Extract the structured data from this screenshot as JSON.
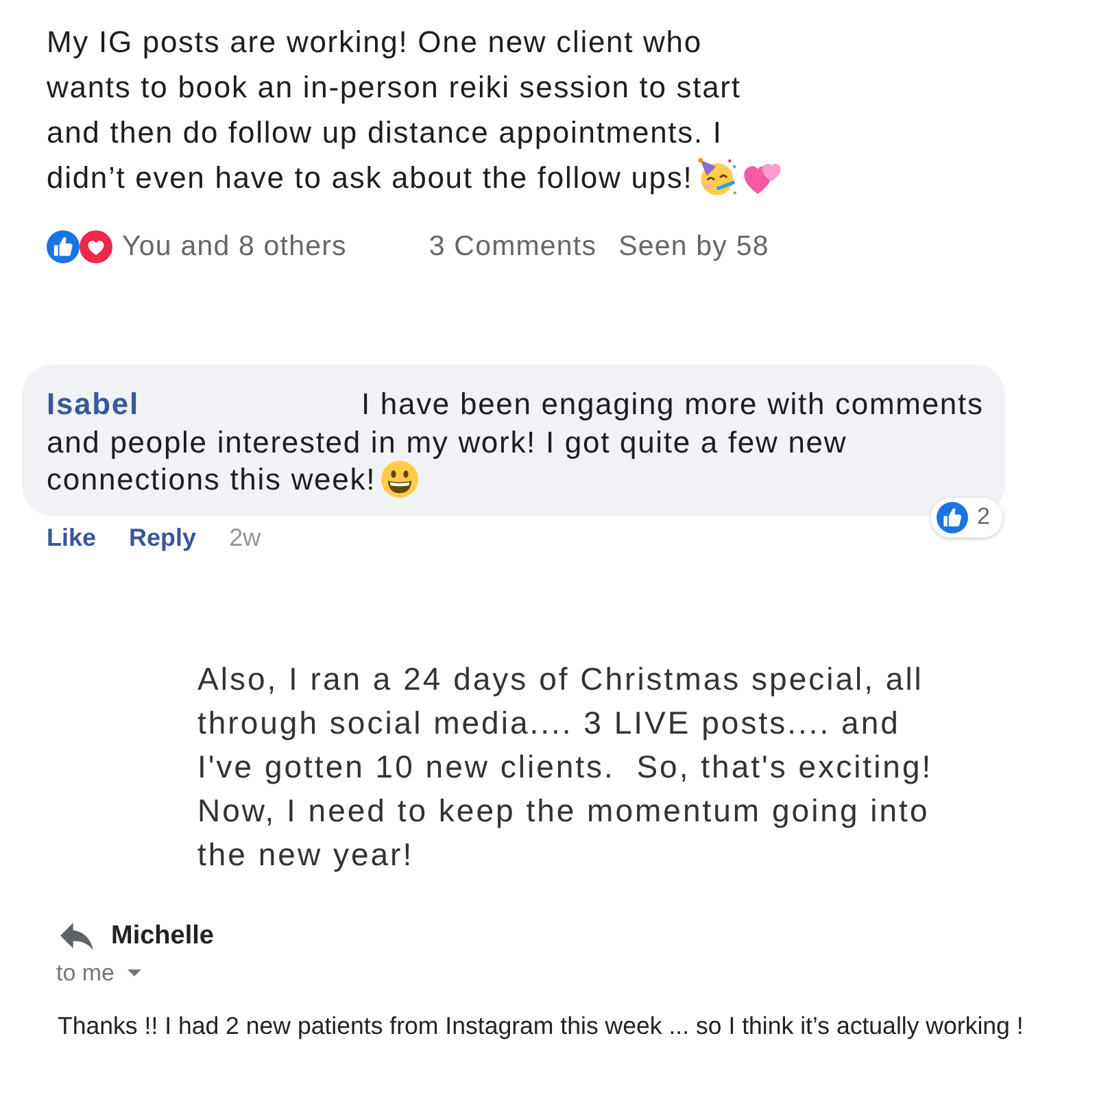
{
  "post": {
    "text": "My IG posts are working! One new client who wants to book an in-person reiki session to start and then do follow up distance appointments. I didn’t even have to ask about the follow ups!",
    "reactions_summary": "You and 8 others",
    "comments_count": "3 Comments",
    "seen_by": "Seen by 58"
  },
  "comment": {
    "author": "Isabel",
    "text": "I have been engaging more with comments and people interested in my work! I got quite a few new connections this week!",
    "reaction_count": "2",
    "actions": [
      {
        "label": "Like"
      },
      {
        "label": "Reply"
      }
    ],
    "time": "2w"
  },
  "message": {
    "text": "Also, I ran a 24 days of Christmas special, all through social media.... 3 LIVE posts.... and I've gotten 10 new clients.  So, that's exciting! Now, I need to keep the momentum going into the new year!"
  },
  "email": {
    "sender": "Michelle",
    "recipient": "to me",
    "body": "Thanks !! I had 2 new patients from Instagram this week ... so I think it’s actually working !"
  }
}
